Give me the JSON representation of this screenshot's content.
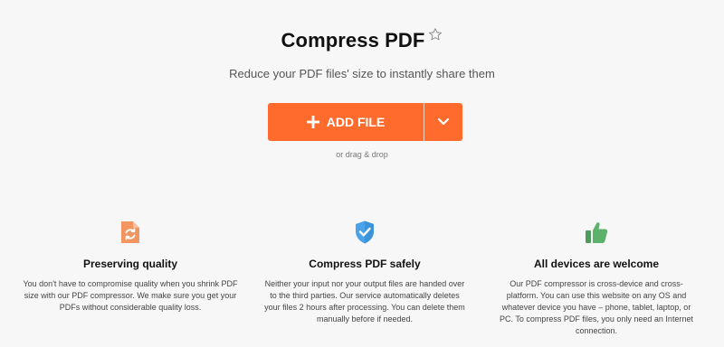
{
  "header": {
    "title": "Compress PDF",
    "subtitle": "Reduce your PDF files' size to instantly share them"
  },
  "upload": {
    "add_file_label": "ADD FILE",
    "drag_drop_text": "or drag & drop"
  },
  "features": [
    {
      "icon": "file-refresh-icon",
      "title": "Preserving quality",
      "text": "You don't have to compromise quality when you shrink PDF size with our PDF compressor. We make sure you get your PDFs without considerable quality loss."
    },
    {
      "icon": "shield-check-icon",
      "title": "Compress PDF safely",
      "text": "Neither your input nor your output files are handed over to the third parties. Our service automatically deletes your files 2 hours after processing. You can delete them manually before if needed."
    },
    {
      "icon": "thumbs-up-icon",
      "title": "All devices are welcome",
      "text": "Our PDF compressor is cross-device and cross-platform. You can use this website on any OS and whatever device you have – phone, tablet, laptop, or PC. To compress PDF files, you only need an Internet connection."
    }
  ],
  "colors": {
    "accent": "#ff6b2c",
    "icon_orange": "#f29560",
    "icon_blue": "#4aa3e8",
    "icon_green": "#5db26b",
    "background": "#f7f7f7"
  }
}
